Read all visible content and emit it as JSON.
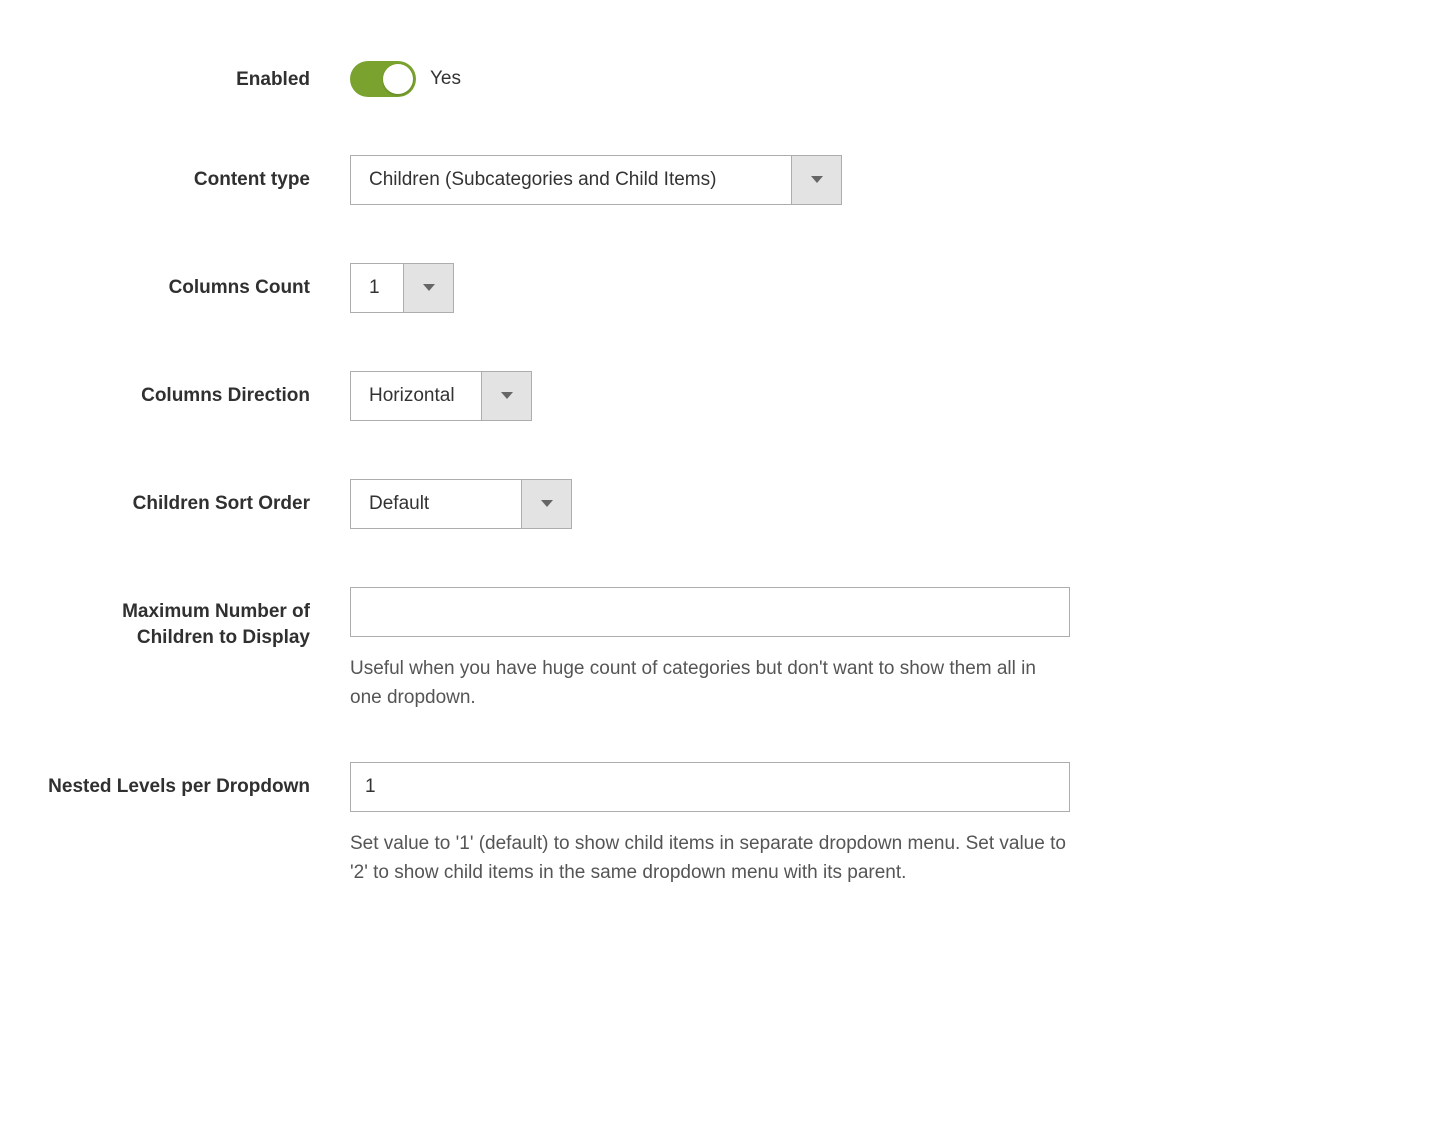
{
  "fields": {
    "enabled": {
      "label": "Enabled",
      "value_label": "Yes"
    },
    "content_type": {
      "label": "Content type",
      "value": "Children (Subcategories and Child Items)"
    },
    "columns_count": {
      "label": "Columns Count",
      "value": "1"
    },
    "columns_direction": {
      "label": "Columns Direction",
      "value": "Horizontal"
    },
    "children_sort_order": {
      "label": "Children Sort Order",
      "value": "Default"
    },
    "max_children": {
      "label": "Maximum Number of Children to Display",
      "value": "",
      "help": "Useful when you have huge count of categories but don't want to show them all in one dropdown."
    },
    "nested_levels": {
      "label": "Nested Levels per Dropdown",
      "value": "1",
      "help": "Set value to '1' (default) to show child items in separate dropdown menu. Set value to '2' to show child items in the same dropdown menu with its parent."
    }
  }
}
